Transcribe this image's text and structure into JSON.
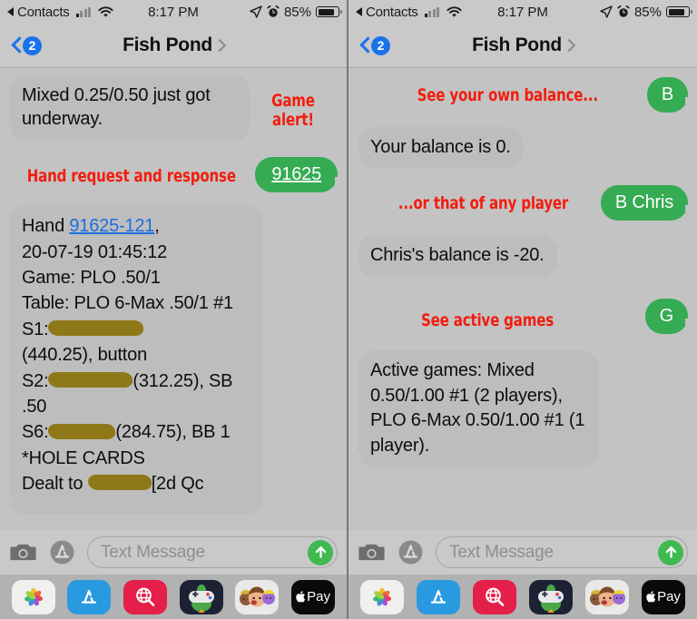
{
  "status_bar": {
    "back_label": "Contacts",
    "time": "8:17 PM",
    "battery_percent": "85%",
    "icons": [
      "back-arrow-icon",
      "signal-bars-icon",
      "wifi-icon",
      "location-arrow-icon",
      "alarm-clock-icon",
      "battery-icon"
    ]
  },
  "nav_bar": {
    "back_badge": "2",
    "title": "Fish Pond"
  },
  "left_panel": {
    "annotations": {
      "game_alert": "Game\nalert!",
      "hand_request": "Hand request and response"
    },
    "messages": [
      {
        "side": "in",
        "text": "Mixed 0.25/0.50 just got underway."
      },
      {
        "side": "out",
        "text": "91625",
        "style": "underlined"
      },
      {
        "side": "in",
        "hand_report": {
          "line1_prefix": "Hand ",
          "hand_id": "91625-121",
          "line1_suffix": ",",
          "timestamp": "20-07-19 01:45:12",
          "game": "Game: PLO .50/1",
          "table": "Table: PLO 6-Max .50/1 #1",
          "seat1_label": "S1:",
          "seat1_info": "(440.25), button",
          "seat2_label": "S2:",
          "seat2_info": "(312.25), SB .50",
          "seat6_label": "S6:",
          "seat6_info": "(284.75), BB 1",
          "hole_cards_header": "*HOLE CARDS",
          "dealt_prefix": "Dealt to ",
          "dealt_suffix": "[2d Qc"
        }
      }
    ]
  },
  "right_panel": {
    "annotations": {
      "own_balance": "See your own balance...",
      "any_player": "...or that of any player",
      "active_games": "See active games"
    },
    "messages": [
      {
        "side": "out",
        "text": "B"
      },
      {
        "side": "in",
        "text": "Your balance is 0."
      },
      {
        "side": "out",
        "text": "B Chris"
      },
      {
        "side": "in",
        "text": "Chris's balance is -20."
      },
      {
        "side": "out",
        "text": "G"
      },
      {
        "side": "in",
        "text": "Active games: Mixed 0.50/1.00 #1 (2 players), PLO 6-Max 0.50/1.00 #1 (1 player)."
      }
    ]
  },
  "toolbar": {
    "camera_icon": "camera-icon",
    "appstore_icon": "app-store-icon",
    "placeholder": "Text Message",
    "send_icon": "send-arrow-up-icon"
  },
  "dock": {
    "apps": [
      {
        "name": "photos-app-icon",
        "label": ""
      },
      {
        "name": "app-store-app-icon",
        "label": ""
      },
      {
        "name": "images-search-app-icon",
        "label": ""
      },
      {
        "name": "game-pigeon-app-icon",
        "label": ""
      },
      {
        "name": "memoji-stickers-app-icon",
        "label": ""
      },
      {
        "name": "apple-pay-app-icon",
        "label": "Pay"
      }
    ]
  },
  "colors": {
    "annotation_red": "#f21d0d",
    "bubble_green": "#35ab53",
    "bubble_gray": "#bdbdbd",
    "link_blue": "#1a6ee0",
    "accent_blue": "#1a72e8",
    "redaction": "#8f7818"
  }
}
